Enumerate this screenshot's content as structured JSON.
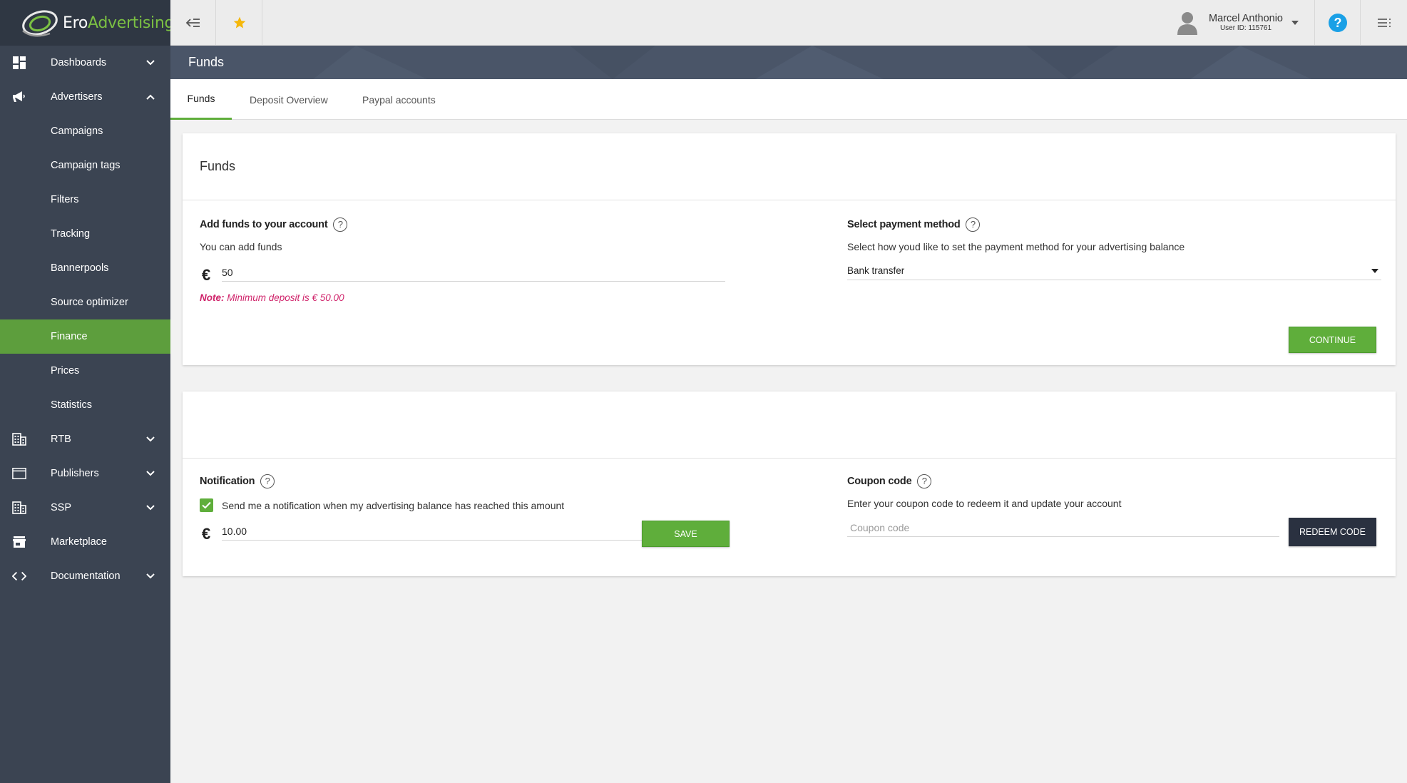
{
  "brand": {
    "logo_prefix": "Ero",
    "logo_suffix": "Advertising",
    "accent_color": "#5fae3b",
    "sidebar_color": "#3b4452"
  },
  "sidebar": {
    "items": [
      {
        "label": "Dashboards",
        "icon": "dashboard-icon",
        "expandable": true
      },
      {
        "label": "Advertisers",
        "icon": "megaphone-icon",
        "expandable": true,
        "expanded": true
      },
      {
        "label": "Campaigns"
      },
      {
        "label": "Campaign tags"
      },
      {
        "label": "Filters"
      },
      {
        "label": "Tracking"
      },
      {
        "label": "Bannerpools"
      },
      {
        "label": "Source optimizer"
      },
      {
        "label": "Finance",
        "active": true
      },
      {
        "label": "Prices"
      },
      {
        "label": "Statistics"
      },
      {
        "label": "RTB",
        "icon": "building-icon",
        "expandable": true
      },
      {
        "label": "Publishers",
        "icon": "browser-window-icon",
        "expandable": true
      },
      {
        "label": "SSP",
        "icon": "building-icon",
        "expandable": true
      },
      {
        "label": "Marketplace",
        "icon": "store-icon"
      },
      {
        "label": "Documentation",
        "icon": "code-icon",
        "expandable": true
      }
    ]
  },
  "topbar": {
    "user_name": "Marcel Anthonio",
    "user_id": "User ID: 115761"
  },
  "page": {
    "title": "Funds"
  },
  "tabs": [
    {
      "label": "Funds",
      "active": true
    },
    {
      "label": "Deposit Overview"
    },
    {
      "label": "Paypal accounts"
    }
  ],
  "funds_card": {
    "title": "Funds",
    "add_funds_label": "Add funds to your account",
    "add_funds_desc": "You can add funds",
    "currency_symbol": "€",
    "amount_value": "50",
    "note_prefix": "Note:",
    "note_text": " Minimum deposit is € 50.00",
    "payment_label": "Select payment method",
    "payment_desc": "Select how youd like to set the payment method for your advertising balance",
    "payment_selected": "Bank transfer",
    "continue_label": "CONTINUE"
  },
  "notify_card": {
    "notification_label": "Notification",
    "notification_checkbox_text": "Send me a notification when my advertising balance has reached this amount",
    "notification_checked": true,
    "currency_symbol": "€",
    "notification_value": "10.00",
    "save_label": "SAVE",
    "coupon_label": "Coupon code",
    "coupon_desc": "Enter your coupon code to redeem it and update your account",
    "coupon_placeholder": "Coupon code",
    "redeem_label": "REDEEM CODE"
  }
}
